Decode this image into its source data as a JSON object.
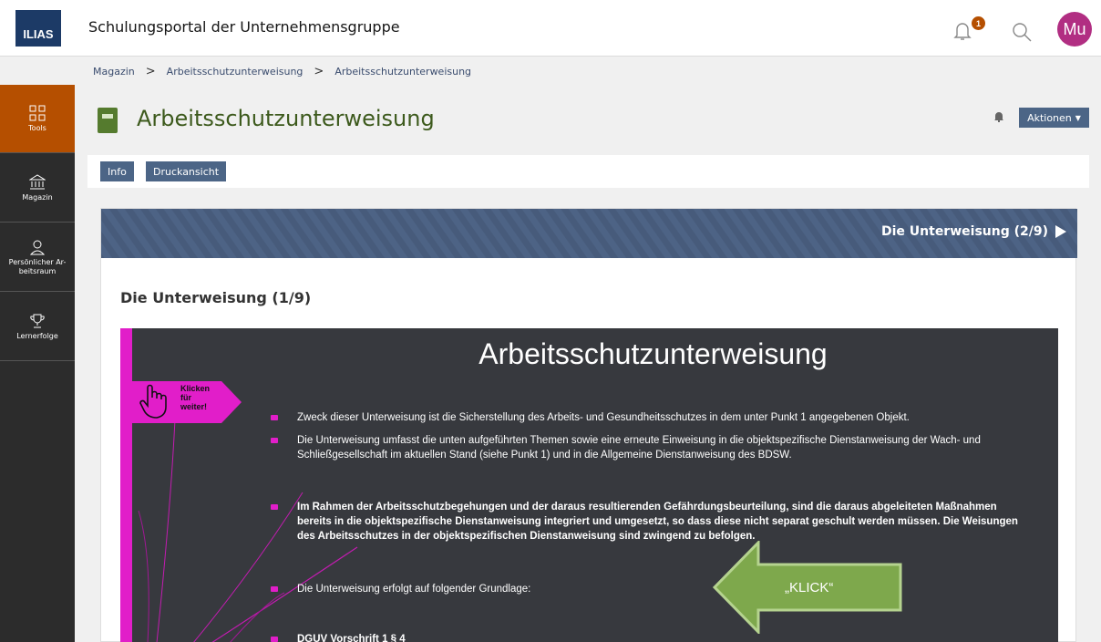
{
  "header": {
    "logo_text": "ILIAS",
    "portal_title": "Schulungsportal der Unternehmensgruppe",
    "notification_count": "1",
    "avatar_initials": "Mu"
  },
  "breadcrumb": [
    "Magazin",
    "Arbeitsschutzunterweisung",
    "Arbeitsschutzunterweisung"
  ],
  "sidebar": {
    "items": [
      {
        "label": "Tools",
        "icon": "grid-icon",
        "active": true
      },
      {
        "label": "Magazin",
        "icon": "bank-icon"
      },
      {
        "label": "Persönlicher Ar-beitsraum",
        "icon": "user-icon"
      },
      {
        "label": "Lernerfolge",
        "icon": "trophy-icon"
      }
    ]
  },
  "page": {
    "title": "Arbeitsschutzunterweisung",
    "actions_label": "Aktionen",
    "tabs": [
      "Info",
      "Druckansicht"
    ],
    "next_link": "Die Unterweisung (2/9)",
    "section_title": "Die Unterweisung (1/9)"
  },
  "slide": {
    "title": "Arbeitsschutzunterweisung",
    "klicken_text": [
      "Klicken",
      "für",
      "weiter!"
    ],
    "bullets": [
      "Zweck dieser Unterweisung ist die Sicherstellung des Arbeits- und Gesundheitsschutzes in dem unter Punkt 1 angegebenen Objekt.",
      "Die Unterweisung umfasst die unten aufgeführten Themen sowie eine erneute Einweisung in die objektspezifische Dienstanweisung der Wach- und Schließgesellschaft im aktuellen Stand (siehe Punkt 1) und in die Allgemeine Dienstanweisung des BDSW.",
      "Im Rahmen der Arbeitsschutzbegehungen und der daraus resultierenden Gefährdungsbeurteilung, sind die daraus abgeleiteten Maßnahmen bereits in die objektspezifische Dienstanweisung integriert und umgesetzt, so dass diese nicht separat geschult werden müssen. Die Weisungen des Arbeitsschutzes in der objektspezifischen Dienstanweisung sind zwingend zu befolgen.",
      "Die Unterweisung erfolgt auf folgender Grundlage:",
      "DGUV Vorschrift 1 § 4"
    ],
    "arrow_label": "„KLICK“"
  },
  "colors": {
    "sidebar_bg": "#2c2c2c",
    "sidebar_active": "#b54f00",
    "button_bg": "#4c6586",
    "title_green": "#3d5a1d",
    "slide_bg": "#37393e",
    "slide_accent": "#e11ec9",
    "arrow_green": "#7ea84c"
  }
}
